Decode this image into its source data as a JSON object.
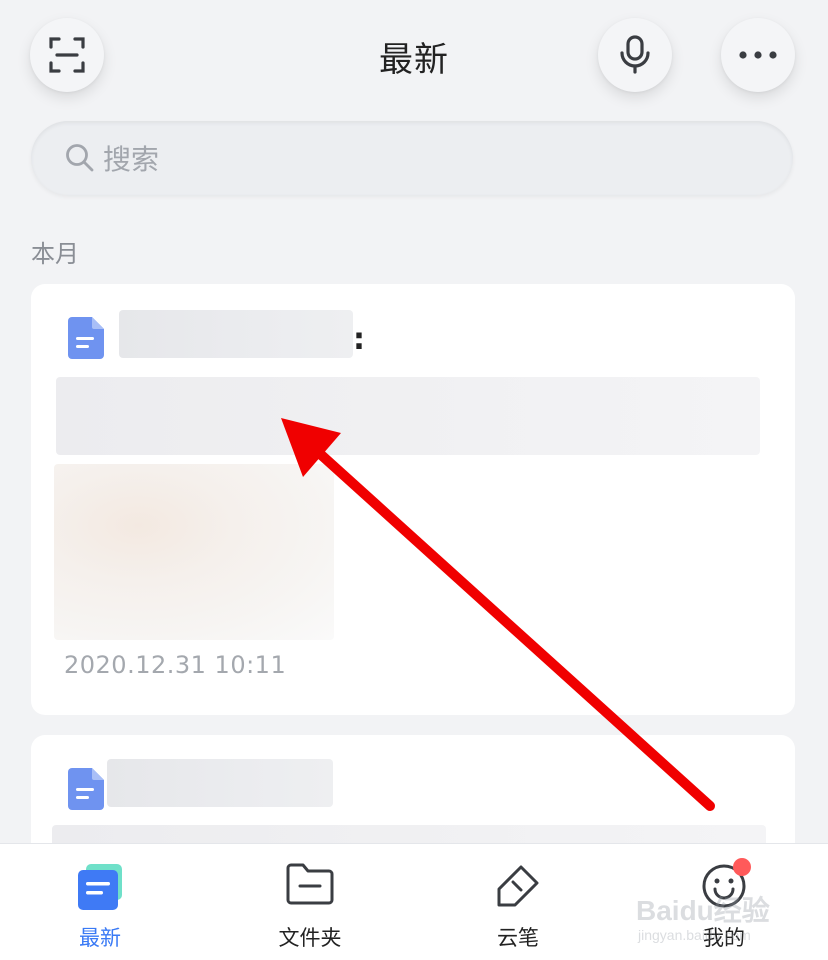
{
  "header": {
    "title": "最新"
  },
  "search": {
    "placeholder": "搜索"
  },
  "section": {
    "label": "本月"
  },
  "notes": [
    {
      "title_suffix": ":",
      "timestamp": "2020.12.31 10:11"
    },
    {}
  ],
  "nav": {
    "items": [
      {
        "label": "最新",
        "icon": "document-stack-icon"
      },
      {
        "label": "文件夹",
        "icon": "folder-icon"
      },
      {
        "label": "云笔",
        "icon": "pen-icon"
      },
      {
        "label": "我的",
        "icon": "smiley-icon"
      }
    ]
  },
  "watermark": {
    "text": "Baidu经验",
    "sub": "jingyan.baidu.com"
  },
  "colors": {
    "accent": "#3a7af5",
    "annotation_arrow": "#f00000",
    "badge": "#ff5a5a"
  }
}
